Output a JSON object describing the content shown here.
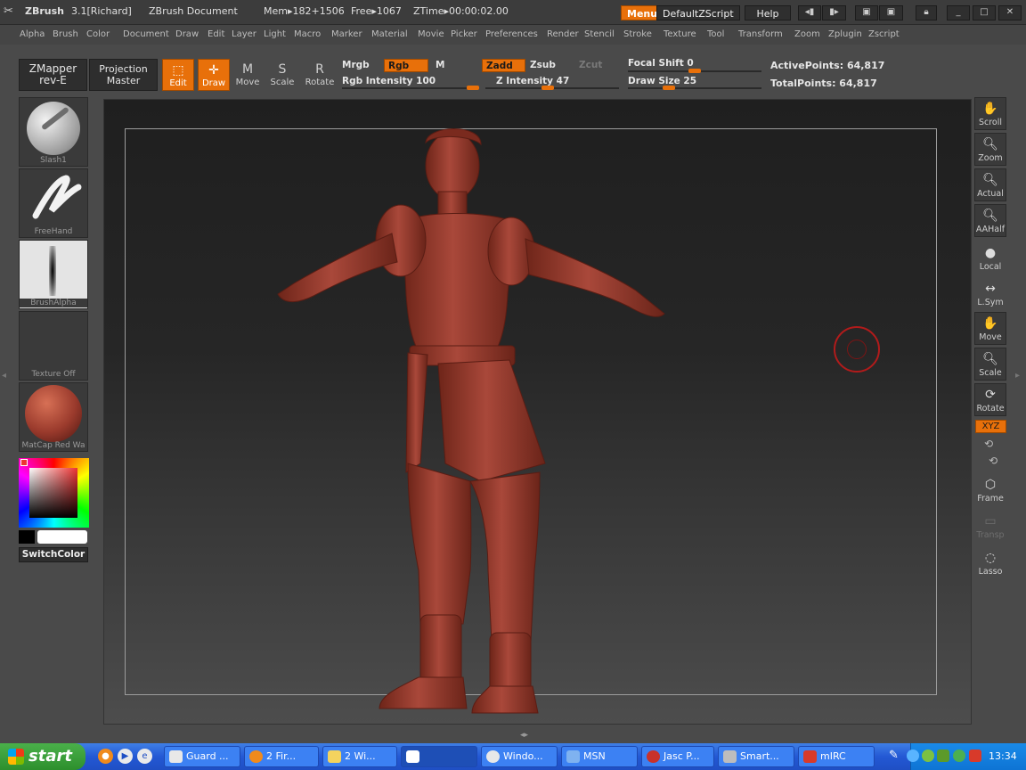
{
  "titlebar": {
    "app": "ZBrush",
    "version": "3.1[Richard]",
    "document": "ZBrush Document",
    "mem": "Mem▸182+1506",
    "free": "Free▸1067",
    "ztime": "ZTime▸00:00:02.00",
    "menus_label": "Menus",
    "zscript_label": "DefaultZScript",
    "help_label": "Help"
  },
  "menubar": [
    "Alpha",
    "Brush",
    "Color",
    "Document",
    "Draw",
    "Edit",
    "Layer",
    "Light",
    "Macro",
    "Marker",
    "Material",
    "Movie",
    "Picker",
    "Preferences",
    "Render",
    "Stencil",
    "Stroke",
    "Texture",
    "Tool",
    "Transform",
    "Zoom",
    "Zplugin",
    "Zscript"
  ],
  "toolbar": {
    "zmapper_line1": "ZMapper",
    "zmapper_line2": "rev-E",
    "projection_line1": "Projection",
    "projection_line2": "Master",
    "edit": "Edit",
    "draw": "Draw",
    "move": "Move",
    "scale": "Scale",
    "rotate": "Rotate",
    "mrgb": "Mrgb",
    "rgb": "Rgb",
    "m": "M",
    "rgb_intensity": "Rgb  Intensity 100",
    "zadd": "Zadd",
    "zsub": "Zsub",
    "zcut": "Zcut",
    "z_intensity": "Z  Intensity 47",
    "focal_shift": "Focal  Shift 0",
    "draw_size": "Draw  Size 25",
    "active_points": "ActivePoints: 64,817",
    "total_points": "TotalPoints: 64,817"
  },
  "left_panel": {
    "brush": "Slash1",
    "stroke": "FreeHand",
    "alpha": "BrushAlpha",
    "texture": "Texture  Off",
    "material": "MatCap  Red  Wa",
    "switch_color": "SwitchColor"
  },
  "right_panel": {
    "scroll": "Scroll",
    "zoom": "Zoom",
    "actual": "Actual",
    "aahalf": "AAHalf",
    "local": "Local",
    "lsym": "L.Sym",
    "move": "Move",
    "scale": "Scale",
    "rotate": "Rotate",
    "xyz": "XYZ",
    "frame": "Frame",
    "transp": "Transp",
    "lasso": "Lasso"
  },
  "taskbar": {
    "start": "start",
    "tasks": [
      "Guard ...",
      "2 Fir...",
      "2 Wi...",
      "",
      "Windo...",
      "MSN",
      "Jasc P...",
      "Smart...",
      "mIRC"
    ],
    "clock": "13:34"
  },
  "colors": {
    "accent": "#e8700a",
    "model": "#9a3a2c",
    "taskbar": "#2358d4"
  }
}
